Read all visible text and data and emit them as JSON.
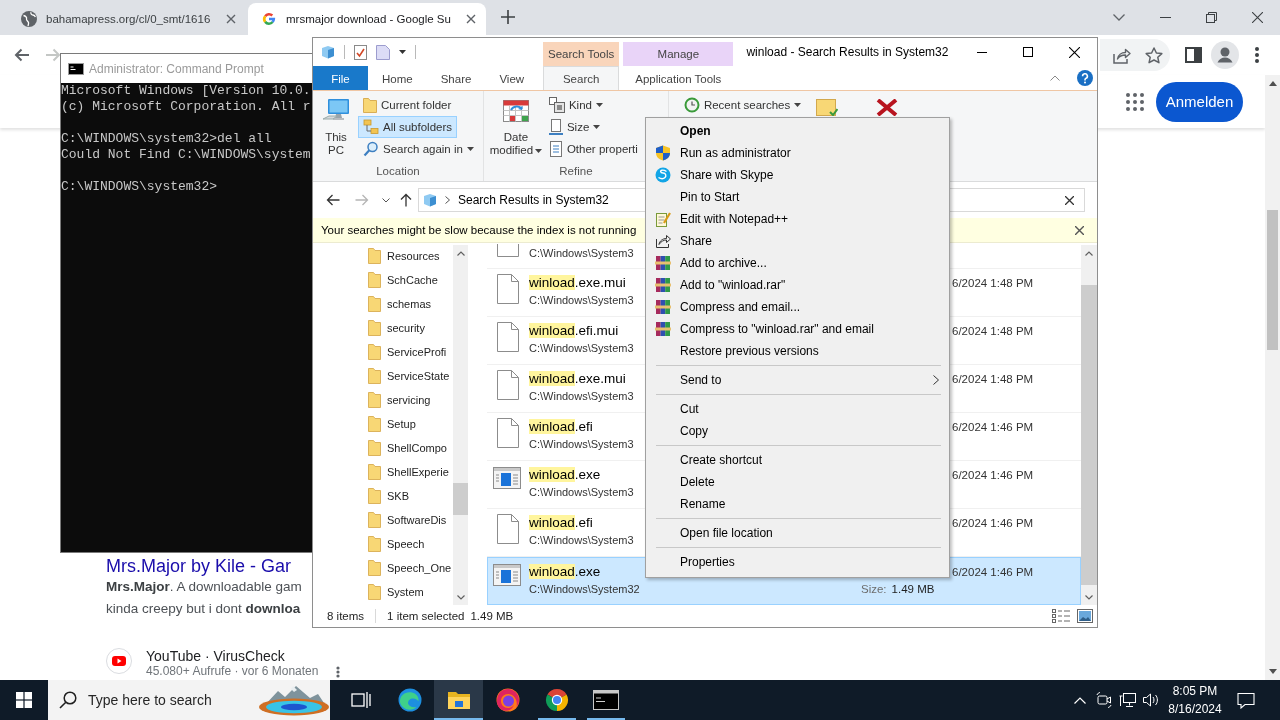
{
  "browser": {
    "tabs": [
      {
        "title": "bahamapress.org/cl/0_smt/1616",
        "selected": false
      },
      {
        "title": "mrsmajor download - Google Su",
        "selected": true
      }
    ],
    "forward_disabled": true,
    "sign_in": "Anmelden",
    "results": [
      {
        "kind": "web",
        "title": "Mrs.Major by Kile - Gar",
        "snippet": [
          "**Mrs.Major**. A downloadable gam",
          "kinda creepy but i dont **downloa**"
        ]
      },
      {
        "kind": "video",
        "source": "YouTube · VirusCheck",
        "meta": "45.080+ Aufrufe · vor 6 Monaten"
      }
    ]
  },
  "cmd": {
    "title": "Administrator: Command Prompt",
    "blocks": [
      [
        "Microsoft Windows [Version 10.0.",
        "(c) Microsoft Corporation. All r"
      ],
      [
        "C:\\WINDOWS\\system32>del all",
        "Could Not Find C:\\WINDOWS\\system"
      ],
      [
        "C:\\WINDOWS\\system32>"
      ]
    ]
  },
  "explorer": {
    "title": "winload - Search Results in System32",
    "tabs": [
      {
        "label": "File",
        "kind": "file",
        "selected": false
      },
      {
        "label": "Home",
        "kind": "plain",
        "selected": false
      },
      {
        "label": "Share",
        "kind": "plain",
        "selected": false
      },
      {
        "label": "View",
        "kind": "plain",
        "selected": false
      }
    ],
    "contextual": [
      {
        "header": "Search Tools",
        "color": "#f9d5bb",
        "tab": {
          "label": "Search",
          "selected": true
        }
      },
      {
        "header": "Manage",
        "color": "#e9d4f8",
        "tab": {
          "label": "Application Tools",
          "selected": false
        }
      }
    ],
    "groups": [
      {
        "label": "Location",
        "large": [
          {
            "label": "This PC",
            "dropdown": false
          }
        ],
        "small": [
          {
            "label": "Current folder",
            "dropdown": false,
            "selected": false
          },
          {
            "label": "All subfolders",
            "dropdown": false,
            "selected": true
          },
          {
            "label": "Search again in",
            "dropdown": true,
            "selected": false
          }
        ]
      },
      {
        "label": "Refine",
        "large": [
          {
            "label": "Date modified",
            "dropdown": true
          }
        ],
        "small": [
          {
            "label": "Kind",
            "dropdown": true,
            "selected": false
          },
          {
            "label": "Size",
            "dropdown": true,
            "selected": false
          },
          {
            "label": "Other properti",
            "dropdown": false,
            "selected": false
          }
        ]
      },
      {
        "small": [
          {
            "label": "Recent searches",
            "dropdown": true,
            "selected": false
          }
        ]
      }
    ],
    "forward_disabled": true,
    "address": "Search Results in System32",
    "notice": "Your searches might be slow because the index is not running",
    "folders": [
      {
        "label": "Resources"
      },
      {
        "label": "SchCache"
      },
      {
        "label": "schemas"
      },
      {
        "label": "security"
      },
      {
        "label": "ServiceProfi"
      },
      {
        "label": "ServiceState"
      },
      {
        "label": "servicing"
      },
      {
        "label": "Setup"
      },
      {
        "label": "ShellCompo"
      },
      {
        "label": "ShellExperie"
      },
      {
        "label": "SKB"
      },
      {
        "label": "SoftwareDis"
      },
      {
        "label": "Speech"
      },
      {
        "label": "Speech_One"
      },
      {
        "label": "System"
      }
    ],
    "files": [
      {
        "kind": "doc",
        "path": "C:\\Windows\\System3",
        "selected": false
      },
      {
        "kind": "doc",
        "match": "winload",
        "rest": ".exe.mui",
        "path": "C:\\Windows\\System3",
        "date": "6/2024 1:48 PM",
        "selected": false
      },
      {
        "kind": "doc",
        "match": "winload",
        "rest": ".efi.mui",
        "path": "C:\\Windows\\System3",
        "date": "6/2024 1:48 PM",
        "selected": false
      },
      {
        "kind": "doc",
        "match": "winload",
        "rest": ".exe.mui",
        "path": "C:\\Windows\\System3",
        "date": "6/2024 1:48 PM",
        "selected": false
      },
      {
        "kind": "doc",
        "match": "winload",
        "rest": ".efi",
        "path": "C:\\Windows\\System3",
        "date": "6/2024 1:46 PM",
        "selected": false
      },
      {
        "kind": "app",
        "match": "winload",
        "rest": ".exe",
        "path": "C:\\Windows\\System3",
        "date": "6/2024 1:46 PM",
        "selected": false
      },
      {
        "kind": "doc",
        "match": "winload",
        "rest": ".efi",
        "path": "C:\\Windows\\System3",
        "date": "6/2024 1:46 PM",
        "selected": false
      },
      {
        "kind": "app",
        "match": "winload",
        "rest": ".exe",
        "path": "C:\\Windows\\System32",
        "size_label": "Size:",
        "size": "1.49 MB",
        "date": "6/2024 1:46 PM",
        "selected": true
      }
    ],
    "status": {
      "count": "8 items",
      "selection": "1 item selected",
      "size": "1.49 MB"
    }
  },
  "context_menu": {
    "groups": [
      [
        {
          "label": "Open",
          "kind": "default"
        },
        {
          "label": "Run as administrator",
          "kind": "action"
        },
        {
          "label": "Share with Skype",
          "kind": "action"
        },
        {
          "label": "Pin to Start",
          "kind": "action"
        },
        {
          "label": "Edit with Notepad++",
          "kind": "action"
        },
        {
          "label": "Share",
          "kind": "action"
        },
        {
          "label": "Add to archive...",
          "kind": "action"
        },
        {
          "label": "Add to \"winload.rar\"",
          "kind": "action"
        },
        {
          "label": "Compress and email...",
          "kind": "action"
        },
        {
          "label": "Compress to \"winload.rar\" and email",
          "kind": "action"
        },
        {
          "label": "Restore previous versions",
          "kind": "action"
        }
      ],
      [
        {
          "label": "Send to",
          "kind": "submenu"
        }
      ],
      [
        {
          "label": "Cut",
          "kind": "action"
        },
        {
          "label": "Copy",
          "kind": "action"
        }
      ],
      [
        {
          "label": "Create shortcut",
          "kind": "action"
        },
        {
          "label": "Delete",
          "kind": "action"
        },
        {
          "label": "Rename",
          "kind": "action"
        }
      ],
      [
        {
          "label": "Open file location",
          "kind": "action"
        }
      ],
      [
        {
          "label": "Properties",
          "kind": "action"
        }
      ]
    ]
  },
  "taskbar": {
    "placeholder": "Type here to search",
    "apps": [
      {
        "selected": false,
        "running": false
      },
      {
        "selected": true,
        "running": true
      },
      {
        "selected": false,
        "running": false
      },
      {
        "selected": false,
        "running": true
      },
      {
        "selected": false,
        "running": true
      }
    ],
    "time": "8:05 PM",
    "date": "8/16/2024"
  }
}
